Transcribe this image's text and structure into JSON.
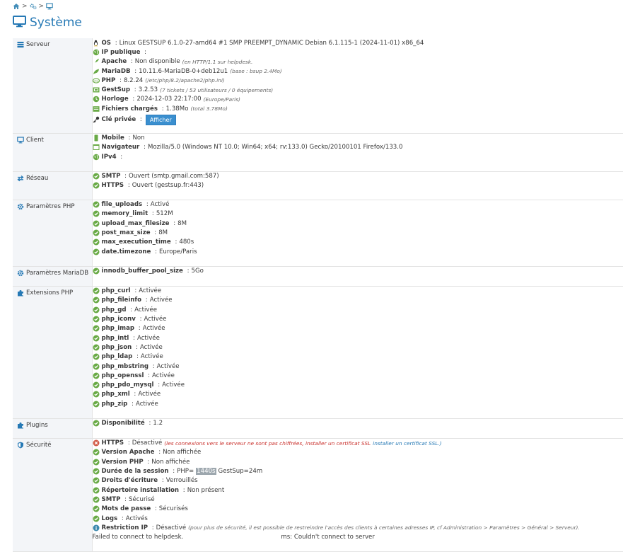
{
  "breadcrumb": {
    "sep": ">"
  },
  "page": {
    "title": "Système"
  },
  "sections": {
    "serveur": {
      "label": "Serveur",
      "os": {
        "k": "OS",
        "v": "Linux GESTSUP 6.1.0-27-amd64 #1 SMP PREEMPT_DYNAMIC Debian 6.1.115-1 (2024-11-01) x86_64"
      },
      "ip": {
        "k": "IP publique"
      },
      "apache": {
        "k": "Apache",
        "v": "Non disponible",
        "n": "(en HTTP/1.1 sur helpdesk."
      },
      "mariadb": {
        "k": "MariaDB",
        "v": "10.11.6-MariaDB-0+deb12u1",
        "n": "(base : bsup 2.4Mo)"
      },
      "php": {
        "k": "PHP",
        "v": "8.2.24",
        "n": "(/etc/php/8.2/apache2/php.ini)"
      },
      "gestsup": {
        "k": "GestSup",
        "v": "3.2.53",
        "n": "(7 tickets / 53 utilisateurs / 0 équipements)"
      },
      "horloge": {
        "k": "Horloge",
        "v": "2024-12-03 22:17:00",
        "n": "(Europe/Paris)"
      },
      "fichiers": {
        "k": "Fichiers chargés",
        "v": "1.38Mo",
        "n": "(total 3.78Mo)"
      },
      "cle": {
        "k": "Clé privée",
        "btn": "Afficher"
      }
    },
    "client": {
      "label": "Client",
      "mobile": {
        "k": "Mobile",
        "v": "Non"
      },
      "nav": {
        "k": "Navigateur",
        "v": "Mozilla/5.0 (Windows NT 10.0; Win64; x64; rv:133.0) Gecko/20100101 Firefox/133.0"
      },
      "ipv4": {
        "k": "IPv4"
      }
    },
    "reseau": {
      "label": "Réseau",
      "smtp": {
        "k": "SMTP",
        "v": "Ouvert (smtp.gmail.com:587)"
      },
      "https": {
        "k": "HTTPS",
        "v": "Ouvert (gestsup.fr:443)"
      }
    },
    "php_params": {
      "label": "Paramètres PHP",
      "items": [
        {
          "k": "file_uploads",
          "v": "Activé"
        },
        {
          "k": "memory_limit",
          "v": "512M"
        },
        {
          "k": "upload_max_filesize",
          "v": "8M"
        },
        {
          "k": "post_max_size",
          "v": "8M"
        },
        {
          "k": "max_execution_time",
          "v": "480s"
        },
        {
          "k": "date.timezone",
          "v": "Europe/Paris"
        }
      ]
    },
    "mariadb_params": {
      "label": "Paramètres MariaDB",
      "items": [
        {
          "k": "innodb_buffer_pool_size",
          "v": "5Go"
        }
      ]
    },
    "extensions": {
      "label": "Extensions PHP",
      "items": [
        {
          "k": "php_curl",
          "v": "Activée"
        },
        {
          "k": "php_fileinfo",
          "v": "Activée"
        },
        {
          "k": "php_gd",
          "v": "Activée"
        },
        {
          "k": "php_iconv",
          "v": "Activée"
        },
        {
          "k": "php_imap",
          "v": "Activée"
        },
        {
          "k": "php_intl",
          "v": "Activée"
        },
        {
          "k": "php_json",
          "v": "Activée"
        },
        {
          "k": "php_ldap",
          "v": "Activée"
        },
        {
          "k": "php_mbstring",
          "v": "Activée"
        },
        {
          "k": "php_openssl",
          "v": "Activée"
        },
        {
          "k": "php_pdo_mysql",
          "v": "Activée"
        },
        {
          "k": "php_xml",
          "v": "Activée"
        },
        {
          "k": "php_zip",
          "v": "Activée"
        }
      ]
    },
    "plugins": {
      "label": "Plugins",
      "items": [
        {
          "k": "Disponibilité",
          "v": "1.2"
        }
      ]
    },
    "securite": {
      "label": "Sécurité",
      "https": {
        "k": "HTTPS",
        "v": "Désactivé",
        "n": "(les connexions vers le serveur ne sont pas chiffrées, installer un certificat SSL",
        "link": "installer un certificat SSL.)"
      },
      "vapache": {
        "k": "Version Apache",
        "v": "Non affichée"
      },
      "vphp": {
        "k": "Version PHP",
        "v": "Non affichée"
      },
      "session": {
        "k": "Durée de la session",
        "v1": "PHP=",
        "hl": "1440s",
        "v2": "GestSup=24m"
      },
      "droits": {
        "k": "Droits d'écriture",
        "v": "Verrouillés"
      },
      "repertoire": {
        "k": "Répertoire installation",
        "v": "Non présent"
      },
      "smtp": {
        "k": "SMTP",
        "v": "Sécurisé"
      },
      "mdp": {
        "k": "Mots de passe",
        "v": "Sécurisés"
      },
      "logs": {
        "k": "Logs",
        "v": "Activés"
      },
      "restriction": {
        "k": "Restriction IP",
        "v": "Désactivé",
        "n": "(pour plus de sécurité, il est possible de restreindre l'accès des clients à certaines adresses IP, cf Administration > Paramètres > Général > Serveur)."
      },
      "fail1": "Failed to connect to helpdesk.",
      "fail2": "ms: Couldn't connect to server"
    }
  },
  "colors": {
    "accent": "#2679b5",
    "ok": "#69aa46",
    "danger": "#d15b47",
    "info": "#3a87ad"
  }
}
